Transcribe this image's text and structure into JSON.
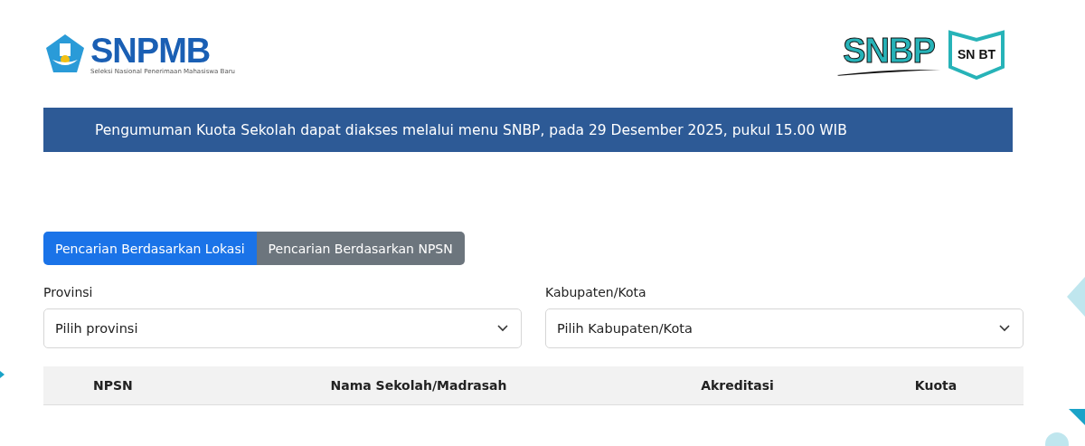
{
  "header": {
    "logo": {
      "name": "SNPMB",
      "tagline": "Seleksi Nasional Penerimaan Mahasiswa Baru"
    },
    "partner_logos": [
      {
        "kind": "snbp",
        "text": "SNBP"
      },
      {
        "kind": "snbt",
        "text": "SN",
        "text_2": "BT"
      }
    ]
  },
  "announcement": "Pengumuman Kuota Sekolah dapat diakses melalui menu SNBP, pada 29 Desember 2025, pukul 15.00 WIB",
  "tabs": [
    {
      "label": "Pencarian Berdasarkan Lokasi",
      "selected": true
    },
    {
      "label": "Pencarian Berdasarkan NPSN",
      "selected": false
    }
  ],
  "fields": [
    {
      "label": "Provinsi",
      "placeholder": "Pilih provinsi"
    },
    {
      "label": "Kabupaten/Kota",
      "placeholder": "Pilih Kabupaten/Kota"
    }
  ],
  "table": {
    "columns": [
      "NPSN",
      "Nama Sekolah/Madrasah",
      "Akreditasi",
      "Kuota"
    ]
  }
}
